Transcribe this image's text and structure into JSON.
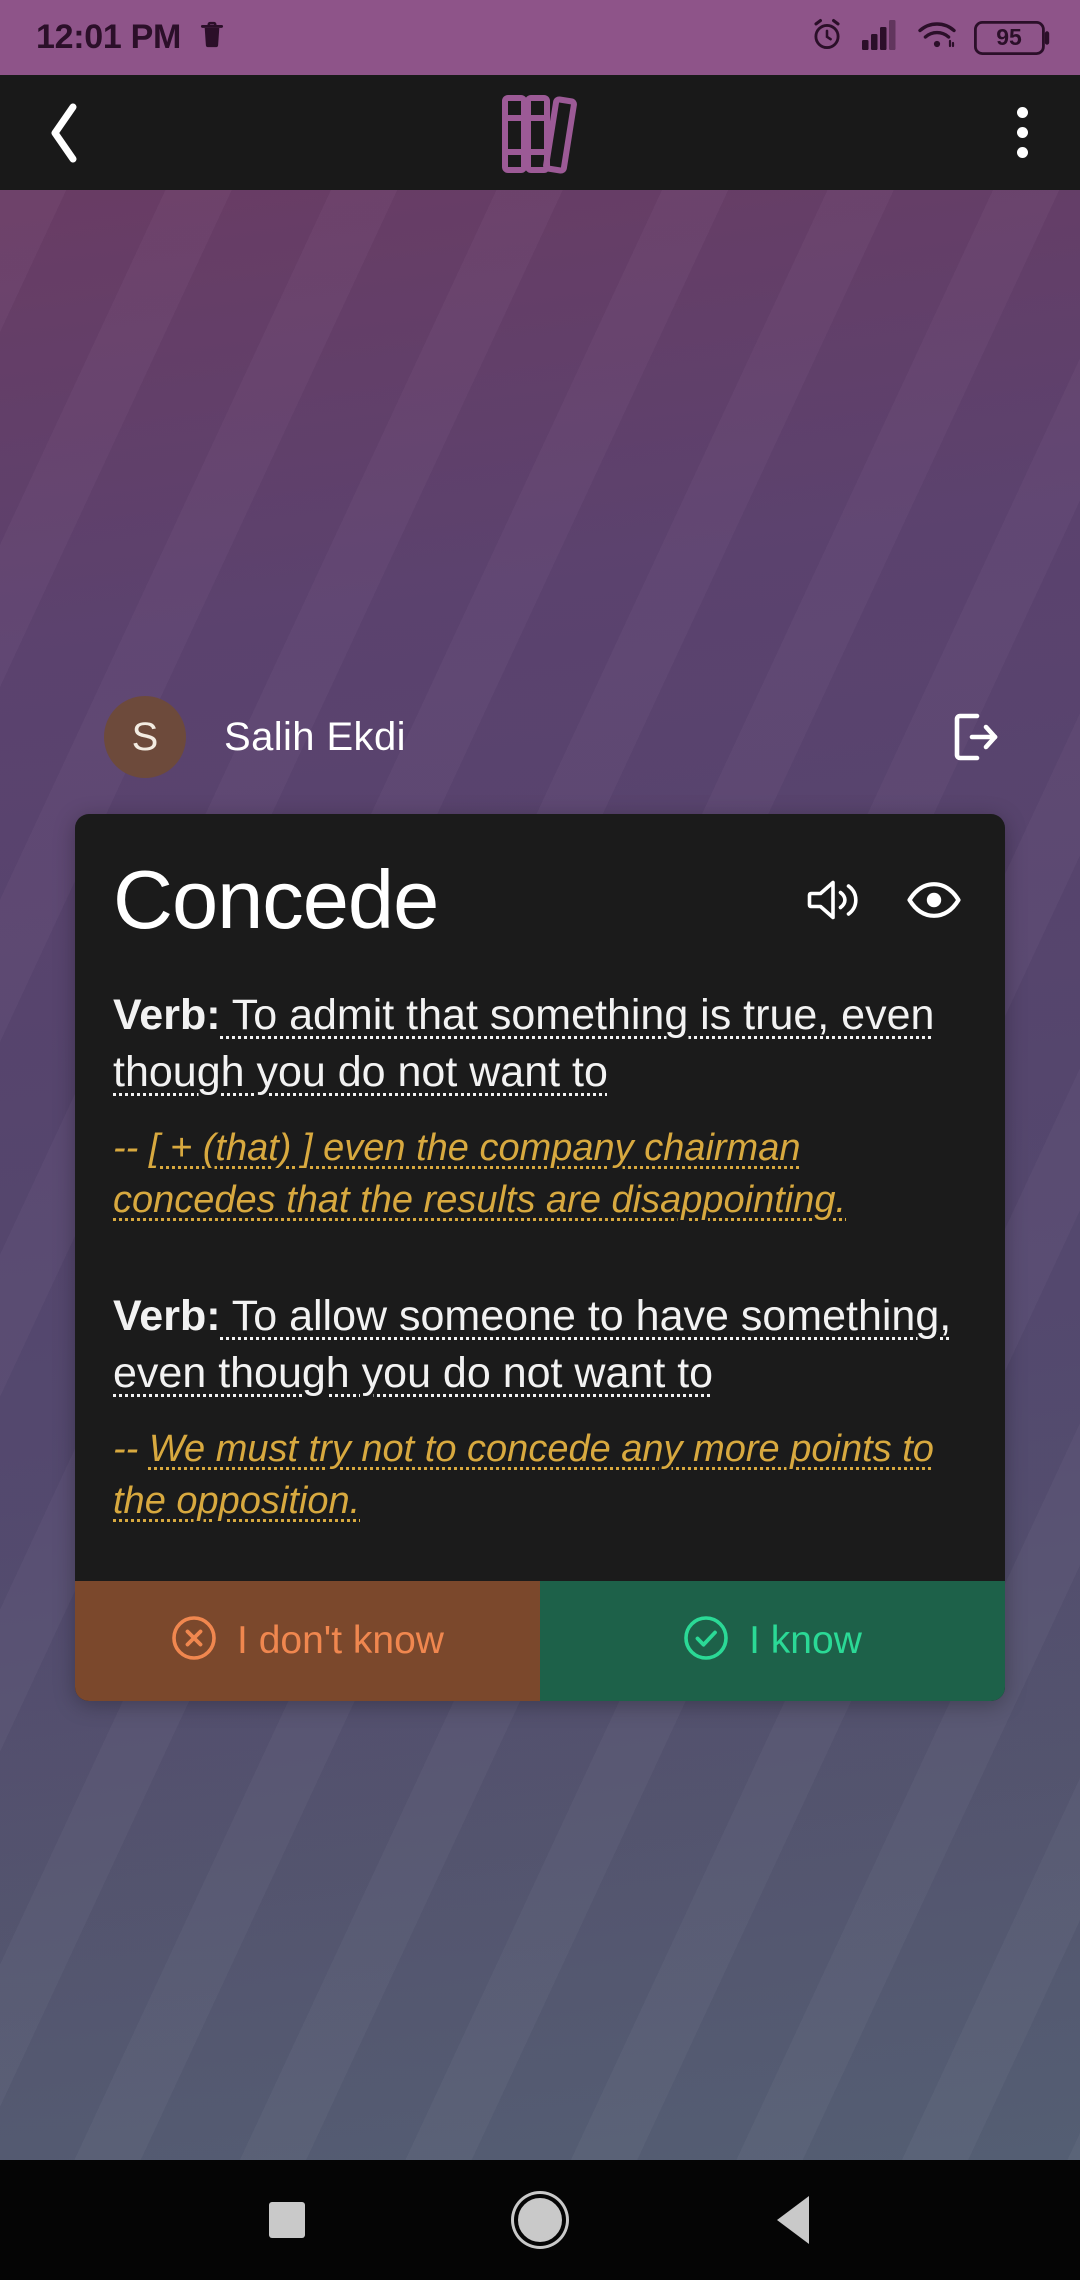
{
  "status_bar": {
    "time": "12:01 PM",
    "left_icons": [
      "trash-icon"
    ],
    "right_icons": [
      "alarm-icon",
      "signal-icon",
      "wifi-icon",
      "battery-icon"
    ],
    "battery_percent": "95",
    "background_color": "#8e5489",
    "foreground_color": "#2b0f29"
  },
  "app_bar": {
    "back_icon": "chevron-left-icon",
    "logo_icon": "books-icon",
    "logo_color": "#9c5a96",
    "overflow_icon": "more-vertical-icon",
    "background_color": "#191919"
  },
  "user": {
    "initial": "S",
    "name": "Salih Ekdi",
    "avatar_color": "#6d4a3b",
    "logout_icon": "logout-icon"
  },
  "flashcard": {
    "word": "Concede",
    "background_color": "#1b1b1b",
    "actions": [
      {
        "icon": "speaker-icon",
        "name": "pronounce-button"
      },
      {
        "icon": "eye-icon",
        "name": "reveal-button"
      }
    ],
    "senses": [
      {
        "pos": "Verb:",
        "definition": " To admit that something is true, even though you do not want to",
        "example_prefix": "-- ",
        "example": "[ + (that) ] even the company chairman concedes that the results are disappointing."
      },
      {
        "pos": "Verb:",
        "definition": " To allow someone to have something, even though you do not want to",
        "example_prefix": "-- ",
        "example": "We must try not to concede any more points to the opposition."
      }
    ],
    "definition_color": "#f2f2f2",
    "example_color": "#d8a93f"
  },
  "answers": {
    "dont_know": {
      "label": "I don't know",
      "icon": "x-circle-icon",
      "background_color": "#7b482c",
      "accent_color": "#f0874f"
    },
    "know": {
      "label": "I know",
      "icon": "check-circle-icon",
      "background_color": "#1d6149",
      "accent_color": "#2bd996"
    }
  },
  "nav_bar": {
    "items": [
      "recents-square-icon",
      "home-circle-icon",
      "back-triangle-icon"
    ],
    "background_color": "#050505",
    "icon_color": "#c9c9c9"
  }
}
